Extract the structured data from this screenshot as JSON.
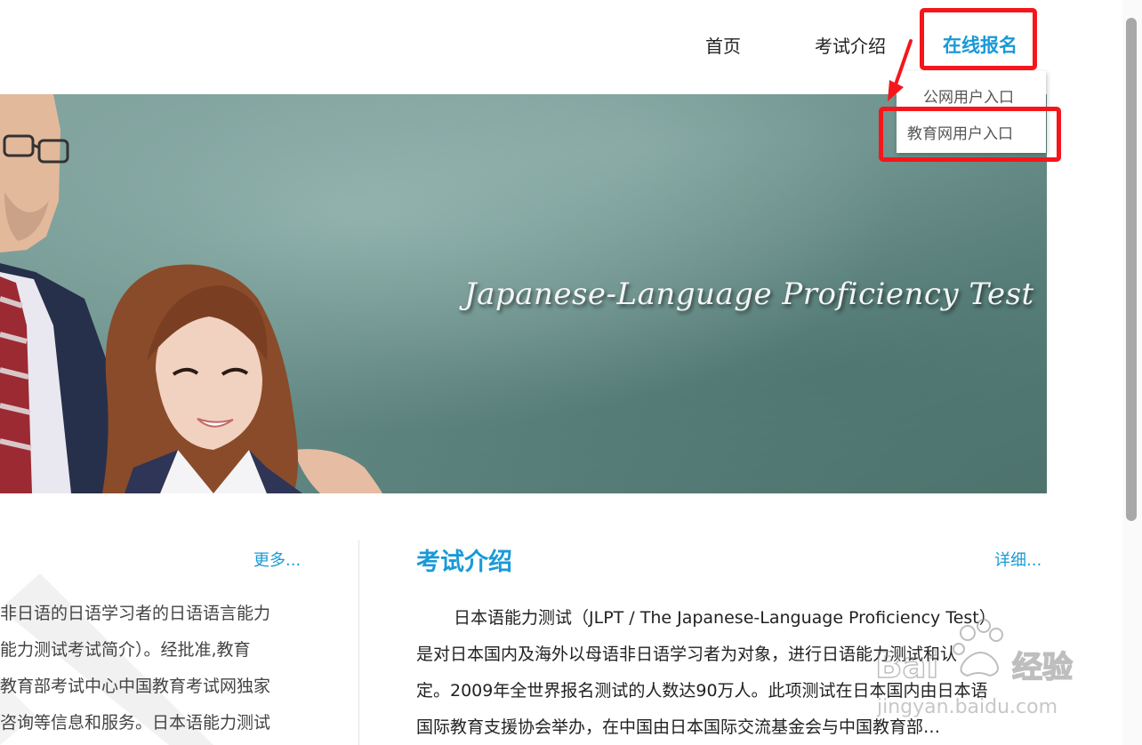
{
  "nav": {
    "home": "首页",
    "exam_intro": "考试介绍",
    "register": "在线报名"
  },
  "dropdown": {
    "public_entry": "公网用户入口",
    "edu_entry": "教育网用户入口"
  },
  "banner": {
    "title": "Japanese-Language Proficiency Test"
  },
  "left_section": {
    "more_link": "更多...",
    "lines": [
      "非日语的日语学习者的日语语言能力",
      "能力测试考试简介）。经批准,教育",
      "教育部考试中心中国教育考试网独家",
      "咨询等信息和服务。日本语能力测试"
    ]
  },
  "intro_section": {
    "title": "考试介绍",
    "detail_link": "详细...",
    "lines": [
      "日本语能力测试（JLPT / The Japanese-Language Proficiency Test）",
      "是对日本国内及海外以母语非日语学习者为对象，进行日语能力测试和认",
      "定。2009年全世界报名测试的人数达90万人。此项测试在日本国内由日本语",
      "国际教育支援协会举办，在中国由日本国际交流基金会与中国教育部…"
    ]
  },
  "watermark": {
    "brand": "Bai",
    "brand_cn": "经验",
    "url": "jingyan.baidu.com"
  },
  "colors": {
    "accent": "#1a9ad6",
    "annotation_red": "#f5161b",
    "banner_green": "#6a8f8a"
  }
}
